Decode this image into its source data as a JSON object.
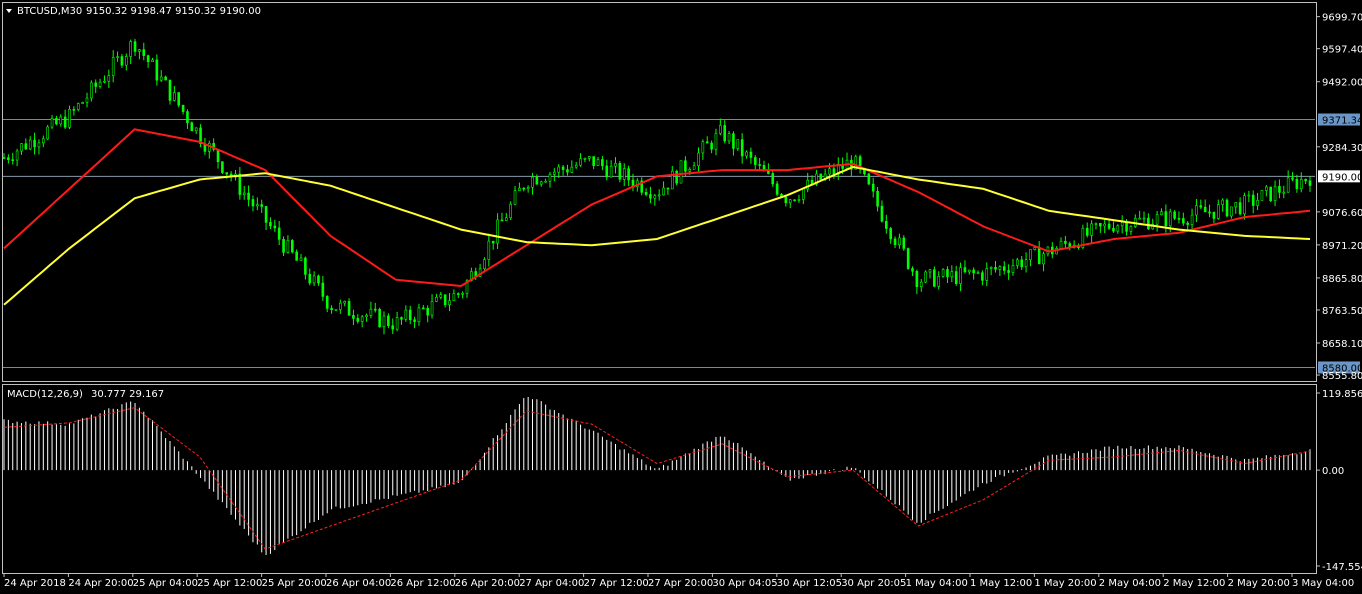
{
  "header": {
    "symbol": "BTCUSD,M30",
    "ohlc": "9150.32 9198.47 9150.32 9190.00"
  },
  "macd_header": {
    "label": "MACD(12,26,9)",
    "values": "30.777 29.167"
  },
  "price_axis": {
    "ticks": [
      "9699.70",
      "9597.40",
      "9492.00",
      "9284.30",
      "9076.60",
      "8971.20",
      "8865.80",
      "8763.50",
      "8658.10",
      "8555.80"
    ],
    "levels": [
      9699.7,
      9597.4,
      9492.0,
      9284.3,
      9076.6,
      8971.2,
      8865.8,
      8763.5,
      8658.1,
      8555.8
    ]
  },
  "hlines": [
    {
      "label": "9371.34",
      "value": 9371.34,
      "color": "#5f8fc0"
    },
    {
      "label": "9190.00",
      "value": 9190.0,
      "color": "#8899aa"
    },
    {
      "label": "8580.00",
      "value": 8580.0,
      "color": "#5f8fc0"
    }
  ],
  "macd_axis": {
    "ticks": [
      "119.856",
      "0.00",
      "-147.554"
    ],
    "levels": [
      119.856,
      0.0,
      -147.554
    ]
  },
  "time_axis": [
    "24 Apr 2018",
    "24 Apr 20:00",
    "25 Apr 04:00",
    "25 Apr 12:00",
    "25 Apr 20:00",
    "26 Apr 04:00",
    "26 Apr 12:00",
    "26 Apr 20:00",
    "27 Apr 04:00",
    "27 Apr 12:00",
    "27 Apr 20:00",
    "30 Apr 04:05",
    "30 Apr 12:05",
    "30 Apr 20:05",
    "1 May 04:00",
    "1 May 12:00",
    "1 May 20:00",
    "2 May 04:00",
    "2 May 12:00",
    "2 May 20:00",
    "3 May 04:00"
  ],
  "colors": {
    "candle": "#00ff00",
    "ma_fast": "#ff1a1a",
    "ma_slow": "#ffff33",
    "macd_hist": "#ffffff",
    "macd_signal": "#ff2020",
    "grid": "#c0c0c0"
  },
  "chart_data": {
    "type": "line",
    "x": [
      "24 Apr 2018",
      "24 Apr 20:00",
      "25 Apr 04:00",
      "25 Apr 12:00",
      "25 Apr 20:00",
      "26 Apr 04:00",
      "26 Apr 12:00",
      "26 Apr 20:00",
      "27 Apr 04:00",
      "27 Apr 12:00",
      "27 Apr 20:00",
      "30 Apr 04:05",
      "30 Apr 12:05",
      "30 Apr 20:05",
      "1 May 04:00",
      "1 May 12:00",
      "1 May 20:00",
      "2 May 04:00",
      "2 May 12:00",
      "2 May 20:00",
      "3 May 04:00"
    ],
    "series": [
      {
        "values": [
          9250,
          9380,
          9620,
          9320,
          9050,
          8780,
          8720,
          8820,
          9180,
          9240,
          9140,
          9330,
          9120,
          9240,
          8860,
          8880,
          8950,
          9040,
          9060,
          9100,
          9190
        ]
      },
      {
        "values": [
          8960,
          9150,
          9340,
          9300,
          9210,
          9000,
          8860,
          8840,
          8970,
          9100,
          9190,
          9210,
          9210,
          9230,
          9140,
          9030,
          8950,
          8990,
          9010,
          9060,
          9080
        ]
      },
      {
        "values": [
          8780,
          8960,
          9120,
          9180,
          9200,
          9160,
          9090,
          9020,
          8980,
          8970,
          8990,
          9060,
          9130,
          9220,
          9180,
          9150,
          9080,
          9050,
          9020,
          9000,
          8990
        ]
      },
      {
        "values": [
          75,
          70,
          105,
          -10,
          -130,
          -60,
          -40,
          -20,
          115,
          60,
          0,
          55,
          -15,
          5,
          -80,
          -20,
          20,
          35,
          35,
          15,
          30
        ]
      },
      {
        "values": [
          65,
          72,
          95,
          20,
          -120,
          -85,
          -50,
          -15,
          90,
          70,
          10,
          40,
          -10,
          0,
          -85,
          -45,
          15,
          20,
          30,
          10,
          29
        ]
      }
    ],
    "ylabel": "",
    "xlabel": "",
    "ylim": [
      8555.8,
      9740
    ],
    "macd_ylim": [
      -147.554,
      119.856
    ]
  }
}
